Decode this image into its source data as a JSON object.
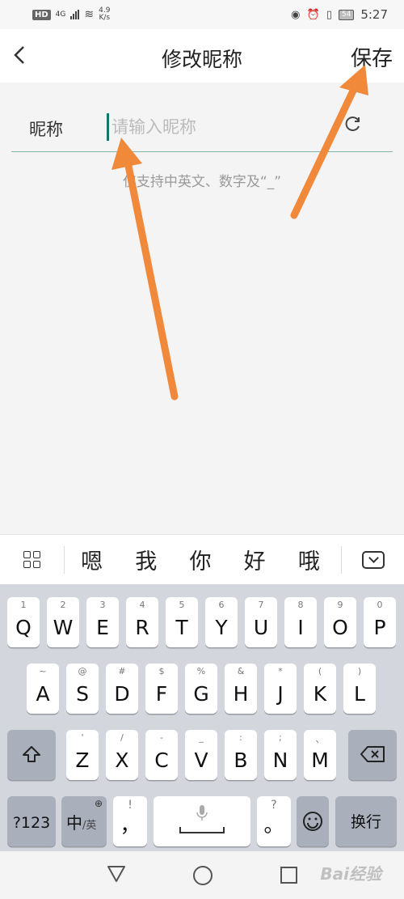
{
  "status_bar": {
    "hd": "HD",
    "network": "4G",
    "speed_value": "4.9",
    "speed_unit": "K/s",
    "battery": "54",
    "time": "5:27"
  },
  "header": {
    "back_icon": "chevron-left-icon",
    "title": "修改昵称",
    "save_label": "保存"
  },
  "form": {
    "label": "昵称",
    "value": "",
    "placeholder": "请输入昵称",
    "refresh_icon": "refresh-icon",
    "hint": "仅支持中英文、数字及“_”"
  },
  "suggestions": {
    "menu_icon": "grid-icon",
    "candidates": [
      "嗯",
      "我",
      "你",
      "好",
      "哦"
    ],
    "collapse_icon": "keyboard-collapse-icon"
  },
  "keyboard": {
    "row1": [
      {
        "main": "Q",
        "sub": "1"
      },
      {
        "main": "W",
        "sub": "2"
      },
      {
        "main": "E",
        "sub": "3"
      },
      {
        "main": "R",
        "sub": "4"
      },
      {
        "main": "T",
        "sub": "5"
      },
      {
        "main": "Y",
        "sub": "6"
      },
      {
        "main": "U",
        "sub": "7"
      },
      {
        "main": "I",
        "sub": "8"
      },
      {
        "main": "O",
        "sub": "9"
      },
      {
        "main": "P",
        "sub": "0"
      }
    ],
    "row2": [
      {
        "main": "A",
        "sub": "~"
      },
      {
        "main": "S",
        "sub": "@"
      },
      {
        "main": "D",
        "sub": "#"
      },
      {
        "main": "F",
        "sub": "$"
      },
      {
        "main": "G",
        "sub": "%"
      },
      {
        "main": "H",
        "sub": "&"
      },
      {
        "main": "J",
        "sub": "*"
      },
      {
        "main": "K",
        "sub": "("
      },
      {
        "main": "L",
        "sub": ")"
      }
    ],
    "row3": [
      {
        "main": "Z",
        "sub": "'"
      },
      {
        "main": "X",
        "sub": "/"
      },
      {
        "main": "C",
        "sub": "-"
      },
      {
        "main": "V",
        "sub": "_"
      },
      {
        "main": "B",
        "sub": ":"
      },
      {
        "main": "N",
        "sub": ";"
      },
      {
        "main": "M",
        "sub": "、"
      }
    ],
    "shift_icon": "shift-icon",
    "backspace_icon": "backspace-icon",
    "num_label": "?123",
    "lang_label_cn": "中",
    "lang_label_en": "/英",
    "globe_icon": "globe-icon",
    "comma_main": "，",
    "comma_sub": "!",
    "mic_icon": "microphone-icon",
    "period_main": "。",
    "period_sub": "?",
    "emoji_icon": "emoji-icon",
    "enter_label": "换行"
  },
  "nav": {
    "back_icon": "nav-back-icon",
    "home_icon": "nav-home-icon",
    "recent_icon": "nav-recent-icon"
  },
  "watermark": "Bai经验"
}
